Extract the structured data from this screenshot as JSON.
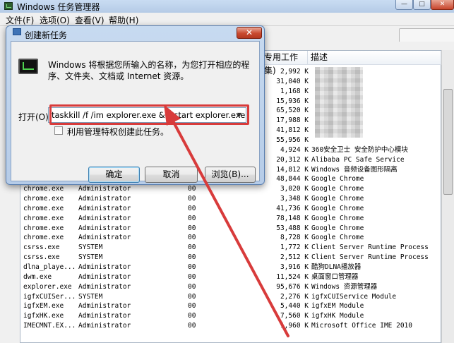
{
  "task_manager": {
    "title": "Windows 任务管理器",
    "menu": [
      "文件(F)",
      "选项(O)",
      "查看(V)",
      "帮助(H)"
    ],
    "window_buttons": {
      "minimize": "—",
      "maximize": "□",
      "close": "✕"
    },
    "columns": {
      "memory": "专用工作集)",
      "description": "描述"
    },
    "top_rows": [
      {
        "mem": "2,992 K",
        "desc": ""
      },
      {
        "mem": "31,040 K",
        "desc": ""
      },
      {
        "mem": "1,168 K",
        "desc": ""
      },
      {
        "mem": "15,936 K",
        "desc": ""
      },
      {
        "mem": "65,520 K",
        "desc": ""
      },
      {
        "mem": "17,988 K",
        "desc": ""
      },
      {
        "mem": "41,812 K",
        "desc": ""
      },
      {
        "mem": "55,956 K",
        "desc": ""
      },
      {
        "mem": "4,924 K",
        "desc": "360安全卫士 安全防护中心模块"
      },
      {
        "mem": "20,312 K",
        "desc": "Alibaba PC Safe Service"
      },
      {
        "mem": "14,812 K",
        "desc": "Windows 音频设备图形隔离"
      },
      {
        "mem": "48,844 K",
        "desc": "Google Chrome"
      }
    ],
    "rows": [
      {
        "name": "chrome.exe",
        "user": "Administrator",
        "cpu": "00",
        "mem": "3,020 K",
        "desc": "Google Chrome"
      },
      {
        "name": "chrome.exe",
        "user": "Administrator",
        "cpu": "00",
        "mem": "3,348 K",
        "desc": "Google Chrome"
      },
      {
        "name": "chrome.exe",
        "user": "Administrator",
        "cpu": "00",
        "mem": "41,736 K",
        "desc": "Google Chrome"
      },
      {
        "name": "chrome.exe",
        "user": "Administrator",
        "cpu": "00",
        "mem": "78,148 K",
        "desc": "Google Chrome"
      },
      {
        "name": "chrome.exe",
        "user": "Administrator",
        "cpu": "00",
        "mem": "53,488 K",
        "desc": "Google Chrome"
      },
      {
        "name": "chrome.exe",
        "user": "Administrator",
        "cpu": "00",
        "mem": "8,728 K",
        "desc": "Google Chrome"
      },
      {
        "name": "csrss.exe",
        "user": "SYSTEM",
        "cpu": "00",
        "mem": "1,772 K",
        "desc": "Client Server Runtime Process"
      },
      {
        "name": "csrss.exe",
        "user": "SYSTEM",
        "cpu": "00",
        "mem": "2,512 K",
        "desc": "Client Server Runtime Process"
      },
      {
        "name": "dlna_playe...",
        "user": "Administrator",
        "cpu": "00",
        "mem": "3,916 K",
        "desc": "酷狗DLNA播放器"
      },
      {
        "name": "dwm.exe",
        "user": "Administrator",
        "cpu": "00",
        "mem": "11,524 K",
        "desc": "桌面窗口管理器"
      },
      {
        "name": "explorer.exe",
        "user": "Administrator",
        "cpu": "00",
        "mem": "95,676 K",
        "desc": "Windows 资源管理器"
      },
      {
        "name": "igfxCUISer...",
        "user": "SYSTEM",
        "cpu": "00",
        "mem": "2,276 K",
        "desc": "igfxCUIService Module"
      },
      {
        "name": "igfxEM.exe",
        "user": "Administrator",
        "cpu": "00",
        "mem": "5,440 K",
        "desc": "igfxEM Module"
      },
      {
        "name": "igfxHK.exe",
        "user": "Administrator",
        "cpu": "00",
        "mem": "7,560 K",
        "desc": "igfxHK Module"
      },
      {
        "name": "IMECMNT.EX...",
        "user": "Administrator",
        "cpu": "00",
        "mem": "1,960 K",
        "desc": "Microsoft Office IME 2010"
      }
    ]
  },
  "run_dialog": {
    "title": "创建新任务",
    "close_label": "✕",
    "description": "Windows 将根据您所输入的名称，为您打开相应的程序、文件夹、文档或 Internet 资源。",
    "open_label": "打开(O):",
    "command_value": "taskkill /f /im explorer.exe && start explorer.exe",
    "dropdown_glyph": "▼",
    "admin_checkbox_label": "利用管理特权创建此任务。",
    "admin_checked": false,
    "buttons": {
      "ok": "确定",
      "cancel": "取消",
      "browse": "浏览(B)..."
    },
    "annotation_color": "#d83b3b"
  }
}
